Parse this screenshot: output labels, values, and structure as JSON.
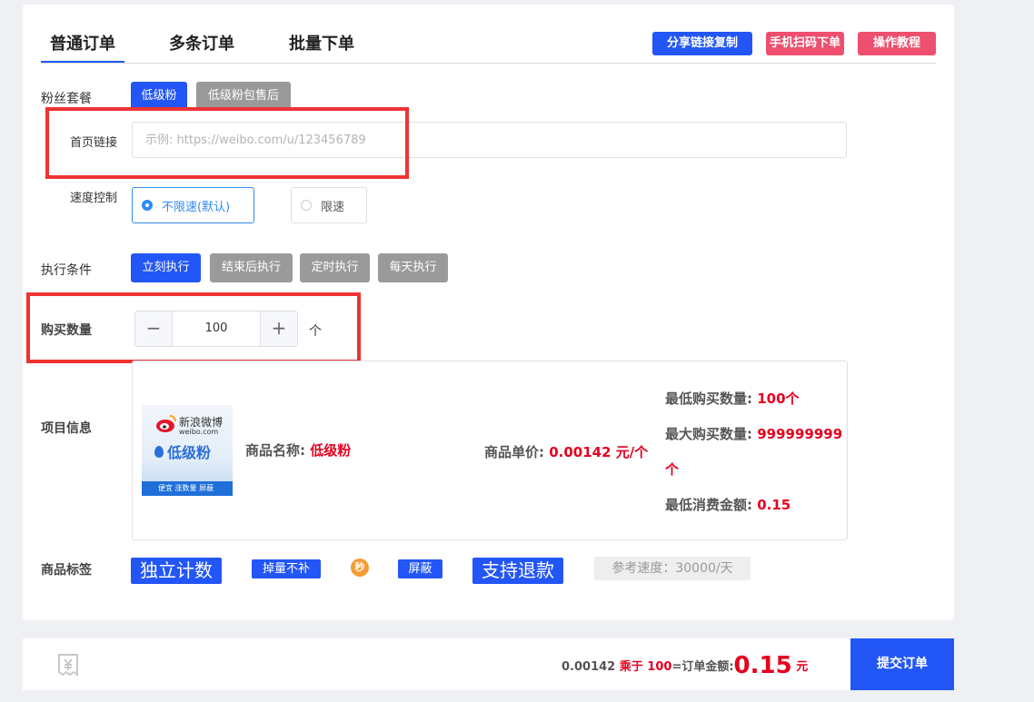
{
  "tabs": [
    "普通订单",
    "多条订单",
    "批量下单"
  ],
  "top_buttons": {
    "share": {
      "label": "分享链接复制",
      "color": "#2356f6"
    },
    "scan": {
      "label": "手机扫码下单",
      "color": "#ef4f6e"
    },
    "tutorial": {
      "label": "操作教程",
      "color": "#ef4f6e"
    }
  },
  "fans_package": {
    "label": "粉丝套餐",
    "options": [
      "低级粉",
      "低级粉包售后"
    ]
  },
  "homepage_link": {
    "label": "首页链接",
    "placeholder": "示例: https://weibo.com/u/123456789"
  },
  "speed_control": {
    "label": "速度控制",
    "options": [
      "不限速(默认)",
      "限速"
    ],
    "selected": "不限速(默认)"
  },
  "execution": {
    "label": "执行条件",
    "options": [
      "立刻执行",
      "结束后执行",
      "定时执行",
      "每天执行"
    ],
    "selected": "立刻执行"
  },
  "quantity": {
    "label": "购买数量",
    "value": "100",
    "unit": "个",
    "minus": "−",
    "plus": "+"
  },
  "project_info": {
    "label": "项目信息",
    "image": {
      "brand": "新浪微博",
      "domain": "weibo.com",
      "product": "低级粉",
      "tagline": "便宜 涨数量 屏蔽"
    },
    "name_label": "商品名称:",
    "name_value": "低级粉",
    "price_label": "商品单价:",
    "price_value": "0.00142 元/个",
    "min_qty_label": "最低购买数量:",
    "min_qty_value": "100个",
    "max_qty_label": "最大购买数量:",
    "max_qty_value": "999999999",
    "max_qty_unit": "个",
    "min_amount_label": "最低消费金额:",
    "min_amount_value": "0.15"
  },
  "tags": {
    "label": "商品标签",
    "items": [
      "独立计数",
      "掉量不补",
      "秒",
      "屏蔽",
      "支持退款"
    ],
    "speed": "参考速度：30000/天"
  },
  "footer": {
    "unit_price": "0.00142",
    "times": "乘于",
    "qty": "100",
    "total_label": "=订单金额:",
    "total": "0.15",
    "currency": "元",
    "submit": "提交订单"
  }
}
